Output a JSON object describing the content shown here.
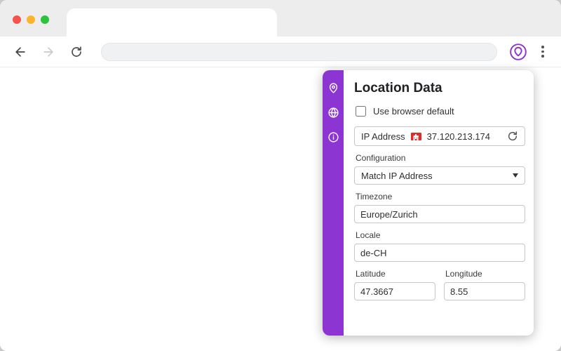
{
  "browser": {
    "url_value": "",
    "accent_color": "#8d35d2",
    "traffic_light_colors": [
      "#f6534e",
      "#fdb42c",
      "#2ac33d"
    ]
  },
  "panel": {
    "title": "Location Data",
    "use_browser_default_label": "Use browser default",
    "use_browser_default_checked": false,
    "ip_address": {
      "label": "IP Address",
      "value": "37.120.213.174",
      "flag": "swiss-flag"
    },
    "configuration": {
      "label": "Configuration",
      "value": "Match IP Address"
    },
    "timezone": {
      "label": "Timezone",
      "value": "Europe/Zurich"
    },
    "locale": {
      "label": "Locale",
      "value": "de-CH"
    },
    "latitude": {
      "label": "Latitude",
      "value": "47.3667"
    },
    "longitude": {
      "label": "Longitude",
      "value": "8.55"
    },
    "sidebar_icons": [
      "location-pin",
      "globe",
      "info"
    ]
  }
}
